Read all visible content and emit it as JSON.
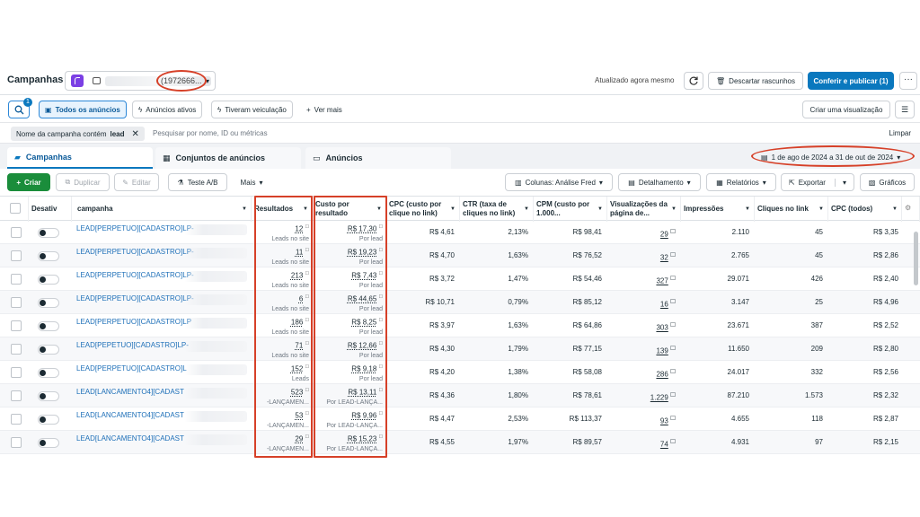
{
  "header": {
    "title": "Campanhas",
    "account_id": "(1972666...",
    "updated": "Atualizado agora mesmo",
    "discard_label": "Descartar rascunhos",
    "publish_label": "Conferir e publicar (1)"
  },
  "filters": {
    "search_badge": "1",
    "all_ads": "Todos os anúncios",
    "active_ads": "Anúncios ativos",
    "had_delivery": "Tiveram veiculação",
    "see_more": "Ver mais",
    "create_view": "Criar uma visualização"
  },
  "search": {
    "token_prefix": "Nome da campanha contém",
    "token_value": "lead",
    "placeholder": "Pesquisar por nome, ID ou métricas",
    "clear": "Limpar"
  },
  "tabs": {
    "campaigns": "Campanhas",
    "adsets": "Conjuntos de anúncios",
    "ads": "Anúncios"
  },
  "date_range": "1 de ago de 2024 a 31 de out de 2024",
  "toolbar": {
    "create": "Criar",
    "duplicate": "Duplicar",
    "edit": "Editar",
    "ab_test": "Teste A/B",
    "more": "Mais",
    "columns": "Colunas: Análise Fred",
    "breakdown": "Detalhamento",
    "reports": "Relatórios",
    "export": "Exportar",
    "charts": "Gráficos"
  },
  "columns": {
    "toggle": "Desativ",
    "campaign": "campanha",
    "results": "Resultados",
    "cost_per_result": "Custo por resultado",
    "cpc_link": "CPC (custo por clique no link)",
    "ctr": "CTR (taxa de cliques no link)",
    "cpm": "CPM (custo por 1.000...",
    "page_views": "Visualizações da página de...",
    "impressions": "Impressões",
    "link_clicks": "Cliques no link",
    "cpc_all": "CPC (todos)"
  },
  "rows": [
    {
      "name": "LEAD[PERPETUO][CADASTRO]LP-",
      "results": "12",
      "results_sub": "Leads no site",
      "cost": "R$ 17,30",
      "cost_sub": "Por lead",
      "cpc": "R$ 4,61",
      "ctr": "2,13%",
      "cpm": "R$ 98,41",
      "views": "29",
      "impressions": "2.110",
      "clicks": "45",
      "cpc_all": "R$ 3,35"
    },
    {
      "name": "LEAD[PERPETUO][CADASTRO]LP-",
      "results": "11",
      "results_sub": "Leads no site",
      "cost": "R$ 19,23",
      "cost_sub": "Por lead",
      "cpc": "R$ 4,70",
      "ctr": "1,63%",
      "cpm": "R$ 76,52",
      "views": "32",
      "impressions": "2.765",
      "clicks": "45",
      "cpc_all": "R$ 2,86"
    },
    {
      "name": "LEAD[PERPETUO][CADASTRO]LP-",
      "results": "213",
      "results_sub": "Leads no site",
      "cost": "R$ 7,43",
      "cost_sub": "Por lead",
      "cpc": "R$ 3,72",
      "ctr": "1,47%",
      "cpm": "R$ 54,46",
      "views": "327",
      "impressions": "29.071",
      "clicks": "426",
      "cpc_all": "R$ 2,40"
    },
    {
      "name": "LEAD[PERPETUO][CADASTRO]LP-",
      "results": "6",
      "results_sub": "Leads no site",
      "cost": "R$ 44,65",
      "cost_sub": "Por lead",
      "cpc": "R$ 10,71",
      "ctr": "0,79%",
      "cpm": "R$ 85,12",
      "views": "16",
      "impressions": "3.147",
      "clicks": "25",
      "cpc_all": "R$ 4,96"
    },
    {
      "name": "LEAD[PERPETUO][CADASTRO]LP",
      "results": "186",
      "results_sub": "Leads no site",
      "cost": "R$ 8,25",
      "cost_sub": "Por lead",
      "cpc": "R$ 3,97",
      "ctr": "1,63%",
      "cpm": "R$ 64,86",
      "views": "303",
      "impressions": "23.671",
      "clicks": "387",
      "cpc_all": "R$ 2,52"
    },
    {
      "name": "LEAD[PEPETUO][CADASTRO]LP-",
      "results": "71",
      "results_sub": "Leads no site",
      "cost": "R$ 12,66",
      "cost_sub": "Por lead",
      "cpc": "R$ 4,30",
      "ctr": "1,79%",
      "cpm": "R$ 77,15",
      "views": "139",
      "impressions": "11.650",
      "clicks": "209",
      "cpc_all": "R$ 2,80"
    },
    {
      "name": "LEAD[PERPETUO][CADASTRO]L",
      "results": "152",
      "results_sub": "Leads",
      "cost": "R$ 9,18",
      "cost_sub": "Por lead",
      "cpc": "R$ 4,20",
      "ctr": "1,38%",
      "cpm": "R$ 58,08",
      "views": "286",
      "impressions": "24.017",
      "clicks": "332",
      "cpc_all": "R$ 2,56"
    },
    {
      "name": "LEAD[LANCAMENTO4][CADAST",
      "results": "523",
      "results_sub": "-LANÇAMEN...",
      "cost": "R$ 13,11",
      "cost_sub": "Por LEAD-LANÇA...",
      "cpc": "R$ 4,36",
      "ctr": "1,80%",
      "cpm": "R$ 78,61",
      "views": "1.229",
      "impressions": "87.210",
      "clicks": "1.573",
      "cpc_all": "R$ 2,32"
    },
    {
      "name": "LEAD[LANCAMENTO4][CADAST",
      "results": "53",
      "results_sub": "-LANÇAMEN...",
      "cost": "R$ 9,96",
      "cost_sub": "Por LEAD-LANÇA...",
      "cpc": "R$ 4,47",
      "ctr": "2,53%",
      "cpm": "R$ 113,37",
      "views": "93",
      "impressions": "4.655",
      "clicks": "118",
      "cpc_all": "R$ 2,87"
    },
    {
      "name": "LEAD[LANCAMENTO4][CADAST",
      "results": "29",
      "results_sub": "-LANÇAMEN...",
      "cost": "R$ 15,23",
      "cost_sub": "Por LEAD-LANÇA...",
      "cpc": "R$ 4,55",
      "ctr": "1,97%",
      "cpm": "R$ 89,57",
      "views": "74",
      "impressions": "4.931",
      "clicks": "97",
      "cpc_all": "R$ 2,15"
    }
  ],
  "icons": [
    "search-icon",
    "refresh-icon",
    "trash-icon",
    "more-icon",
    "settings-icon",
    "calendar-icon",
    "folder-icon",
    "grid-icon",
    "document-icon",
    "columns-icon",
    "chart-icon"
  ],
  "colors": {
    "accent": "#0a78be",
    "create": "#1a8d3b",
    "annotation": "#d64028",
    "link": "#1d6fb8"
  }
}
